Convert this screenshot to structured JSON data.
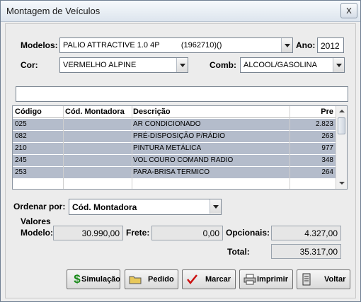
{
  "window": {
    "title": "Montagem de Veículos",
    "close_glyph": "x"
  },
  "form": {
    "modelos_label": "Modelos:",
    "modelo_value": "PALIO ATTRACTIVE 1.0 4P          (1962710)()",
    "ano_label": "Ano:",
    "ano_value": "2012",
    "cor_label": "Cor:",
    "cor_value": "VERMELHO ALPINE",
    "comb_label": "Comb:",
    "comb_value": "ALCOOL/GASOLINA",
    "search_value": ""
  },
  "grid": {
    "columns": [
      "Código",
      "Cód. Montadora",
      "Descrição",
      "Pre"
    ],
    "rows": [
      {
        "codigo": "025",
        "montadora": "",
        "descricao": "AR CONDICIONADO",
        "preco": "2.823"
      },
      {
        "codigo": "082",
        "montadora": "",
        "descricao": "PRÉ-DISPOSIÇÃO P/RÁDIO",
        "preco": "263"
      },
      {
        "codigo": "210",
        "montadora": "",
        "descricao": "PINTURA METÁLICA",
        "preco": "977"
      },
      {
        "codigo": "245",
        "montadora": "",
        "descricao": "VOL COURO COMAND RADIO",
        "preco": "348"
      },
      {
        "codigo": "253",
        "montadora": "",
        "descricao": "PARA-BRISA TERMICO",
        "preco": "264"
      }
    ]
  },
  "sort": {
    "label": "Ordenar por:",
    "value": "Cód. Montadora"
  },
  "valores": {
    "section_label": "Valores",
    "modelo_label": "Modelo:",
    "modelo_value": "30.990,00",
    "frete_label": "Frete:",
    "frete_value": "0,00",
    "opcionais_label": "Opcionais:",
    "opcionais_value": "4.327,00",
    "total_label": "Total:",
    "total_value": "35.317,00"
  },
  "buttons": {
    "simulacao": "Simulação",
    "pedido": "Pedido",
    "marcar": "Marcar",
    "imprimir": "Imprimir",
    "voltar": "Voltar"
  },
  "colors": {
    "row_background": "#b4bccb",
    "simulacao_icon": "#1a8a1a",
    "marcar_icon": "#cc1111"
  },
  "icons": {
    "simulacao": "dollar-icon",
    "pedido": "folder-icon",
    "marcar": "check-mark-icon",
    "imprimir": "printer-icon",
    "voltar": "exit-door-icon"
  }
}
